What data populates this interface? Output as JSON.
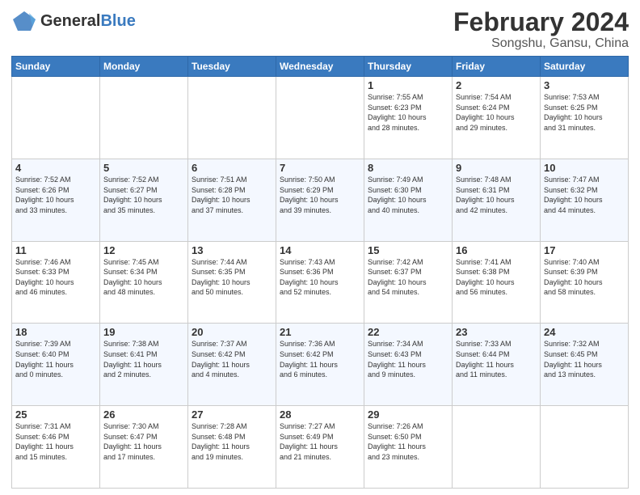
{
  "logo": {
    "general": "General",
    "blue": "Blue"
  },
  "title": "February 2024",
  "subtitle": "Songshu, Gansu, China",
  "days_header": [
    "Sunday",
    "Monday",
    "Tuesday",
    "Wednesday",
    "Thursday",
    "Friday",
    "Saturday"
  ],
  "weeks": [
    [
      {
        "num": "",
        "info": ""
      },
      {
        "num": "",
        "info": ""
      },
      {
        "num": "",
        "info": ""
      },
      {
        "num": "",
        "info": ""
      },
      {
        "num": "1",
        "info": "Sunrise: 7:55 AM\nSunset: 6:23 PM\nDaylight: 10 hours\nand 28 minutes."
      },
      {
        "num": "2",
        "info": "Sunrise: 7:54 AM\nSunset: 6:24 PM\nDaylight: 10 hours\nand 29 minutes."
      },
      {
        "num": "3",
        "info": "Sunrise: 7:53 AM\nSunset: 6:25 PM\nDaylight: 10 hours\nand 31 minutes."
      }
    ],
    [
      {
        "num": "4",
        "info": "Sunrise: 7:52 AM\nSunset: 6:26 PM\nDaylight: 10 hours\nand 33 minutes."
      },
      {
        "num": "5",
        "info": "Sunrise: 7:52 AM\nSunset: 6:27 PM\nDaylight: 10 hours\nand 35 minutes."
      },
      {
        "num": "6",
        "info": "Sunrise: 7:51 AM\nSunset: 6:28 PM\nDaylight: 10 hours\nand 37 minutes."
      },
      {
        "num": "7",
        "info": "Sunrise: 7:50 AM\nSunset: 6:29 PM\nDaylight: 10 hours\nand 39 minutes."
      },
      {
        "num": "8",
        "info": "Sunrise: 7:49 AM\nSunset: 6:30 PM\nDaylight: 10 hours\nand 40 minutes."
      },
      {
        "num": "9",
        "info": "Sunrise: 7:48 AM\nSunset: 6:31 PM\nDaylight: 10 hours\nand 42 minutes."
      },
      {
        "num": "10",
        "info": "Sunrise: 7:47 AM\nSunset: 6:32 PM\nDaylight: 10 hours\nand 44 minutes."
      }
    ],
    [
      {
        "num": "11",
        "info": "Sunrise: 7:46 AM\nSunset: 6:33 PM\nDaylight: 10 hours\nand 46 minutes."
      },
      {
        "num": "12",
        "info": "Sunrise: 7:45 AM\nSunset: 6:34 PM\nDaylight: 10 hours\nand 48 minutes."
      },
      {
        "num": "13",
        "info": "Sunrise: 7:44 AM\nSunset: 6:35 PM\nDaylight: 10 hours\nand 50 minutes."
      },
      {
        "num": "14",
        "info": "Sunrise: 7:43 AM\nSunset: 6:36 PM\nDaylight: 10 hours\nand 52 minutes."
      },
      {
        "num": "15",
        "info": "Sunrise: 7:42 AM\nSunset: 6:37 PM\nDaylight: 10 hours\nand 54 minutes."
      },
      {
        "num": "16",
        "info": "Sunrise: 7:41 AM\nSunset: 6:38 PM\nDaylight: 10 hours\nand 56 minutes."
      },
      {
        "num": "17",
        "info": "Sunrise: 7:40 AM\nSunset: 6:39 PM\nDaylight: 10 hours\nand 58 minutes."
      }
    ],
    [
      {
        "num": "18",
        "info": "Sunrise: 7:39 AM\nSunset: 6:40 PM\nDaylight: 11 hours\nand 0 minutes."
      },
      {
        "num": "19",
        "info": "Sunrise: 7:38 AM\nSunset: 6:41 PM\nDaylight: 11 hours\nand 2 minutes."
      },
      {
        "num": "20",
        "info": "Sunrise: 7:37 AM\nSunset: 6:42 PM\nDaylight: 11 hours\nand 4 minutes."
      },
      {
        "num": "21",
        "info": "Sunrise: 7:36 AM\nSunset: 6:42 PM\nDaylight: 11 hours\nand 6 minutes."
      },
      {
        "num": "22",
        "info": "Sunrise: 7:34 AM\nSunset: 6:43 PM\nDaylight: 11 hours\nand 9 minutes."
      },
      {
        "num": "23",
        "info": "Sunrise: 7:33 AM\nSunset: 6:44 PM\nDaylight: 11 hours\nand 11 minutes."
      },
      {
        "num": "24",
        "info": "Sunrise: 7:32 AM\nSunset: 6:45 PM\nDaylight: 11 hours\nand 13 minutes."
      }
    ],
    [
      {
        "num": "25",
        "info": "Sunrise: 7:31 AM\nSunset: 6:46 PM\nDaylight: 11 hours\nand 15 minutes."
      },
      {
        "num": "26",
        "info": "Sunrise: 7:30 AM\nSunset: 6:47 PM\nDaylight: 11 hours\nand 17 minutes."
      },
      {
        "num": "27",
        "info": "Sunrise: 7:28 AM\nSunset: 6:48 PM\nDaylight: 11 hours\nand 19 minutes."
      },
      {
        "num": "28",
        "info": "Sunrise: 7:27 AM\nSunset: 6:49 PM\nDaylight: 11 hours\nand 21 minutes."
      },
      {
        "num": "29",
        "info": "Sunrise: 7:26 AM\nSunset: 6:50 PM\nDaylight: 11 hours\nand 23 minutes."
      },
      {
        "num": "",
        "info": ""
      },
      {
        "num": "",
        "info": ""
      }
    ]
  ]
}
